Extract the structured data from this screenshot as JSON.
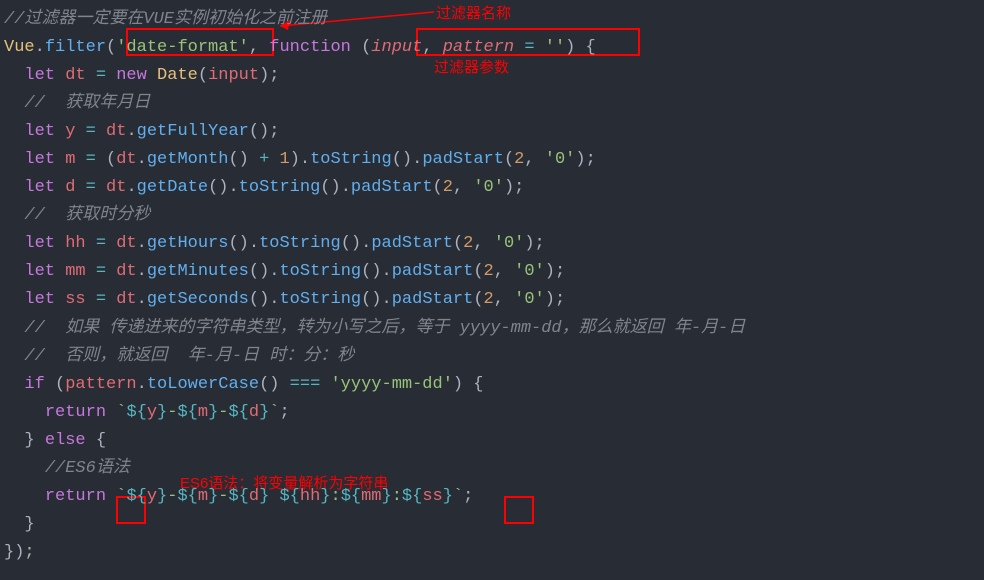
{
  "annotations": {
    "top_comment": "过滤器一定要在VUE实例初始化之前注册",
    "filter_name_label": "过滤器名称",
    "filter_param_label": "过滤器参数",
    "es6_label": "ES6语法：将变量解析为字符串"
  },
  "code": {
    "line1_comment_prefix": "//",
    "obj_vue": "Vue",
    "method_filter": "filter",
    "filter_name_string": "'date-format'",
    "kw_function": "function",
    "param_input": "input",
    "param_pattern": "pattern",
    "default_empty": "''",
    "kw_let": "let",
    "var_dt": "dt",
    "kw_new": "new",
    "class_date": "Date",
    "arg_input": "input",
    "comment_ymd": "//  获取年月日",
    "var_y": "y",
    "method_getFullYear": "getFullYear",
    "var_m": "m",
    "method_getMonth": "getMonth",
    "num_1": "1",
    "method_toString": "toString",
    "method_padStart": "padStart",
    "num_2": "2",
    "str_zero": "'0'",
    "var_d": "d",
    "method_getDate": "getDate",
    "comment_hms": "//  获取时分秒",
    "var_hh": "hh",
    "method_getHours": "getHours",
    "var_mm": "mm",
    "method_getMinutes": "getMinutes",
    "var_ss": "ss",
    "method_getSeconds": "getSeconds",
    "comment_if1": "//  如果 传递进来的字符串类型，转为小写之后，等于 yyyy-mm-dd，那么就返回 年-月-日",
    "comment_if2": "//  否则，就返回  年-月-日 时：分：秒",
    "kw_if": "if",
    "var_pattern": "pattern",
    "method_toLowerCase": "toLowerCase",
    "op_eq": "===",
    "str_yyyy": "'yyyy-mm-dd'",
    "kw_return": "return",
    "kw_else": "else",
    "comment_es6": "//ES6语法",
    "tl_y": "y",
    "tl_m": "m",
    "tl_d": "d",
    "tl_hh": "hh",
    "tl_mm": "mm",
    "tl_ss": "ss"
  }
}
